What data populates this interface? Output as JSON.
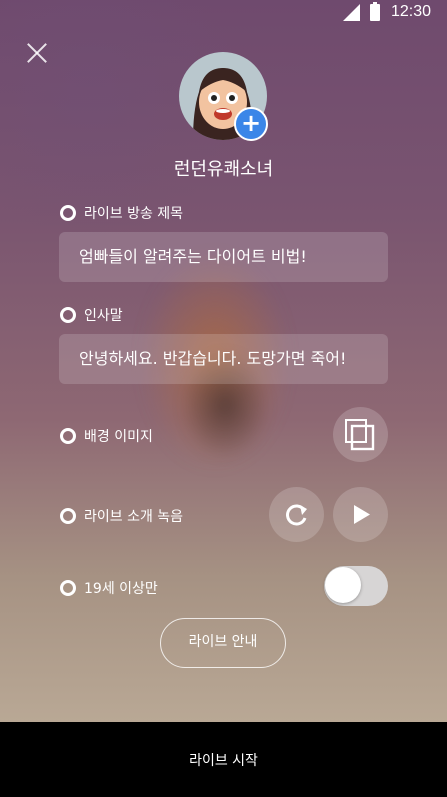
{
  "status_bar": {
    "time": "12:30",
    "signal_icon": "signal-icon",
    "battery_icon": "battery-icon"
  },
  "header": {
    "close_icon": "close-icon",
    "nickname": "런던유쾌소녀",
    "add_photo_icon": "plus-icon"
  },
  "form": {
    "title_label": "라이브 방송 제목",
    "title_value": "엄빠들이 알려주는 다이어트 비법!",
    "greeting_label": "인사말",
    "greeting_value": "안녕하세요. 반갑습니다. 도망가면 죽어!",
    "background_label": "배경 이미지",
    "background_icon": "copy-icon",
    "intro_label": "라이브 소개 녹음",
    "intro_refresh_icon": "refresh-icon",
    "intro_play_icon": "play-icon",
    "adult_label": "19세 이상만",
    "adult_toggle_on": false
  },
  "guide_button": "라이브 안내",
  "start_button": "라이브 시작",
  "colors": {
    "accent": "#3b86e8",
    "bottom_bar": "#000000"
  }
}
